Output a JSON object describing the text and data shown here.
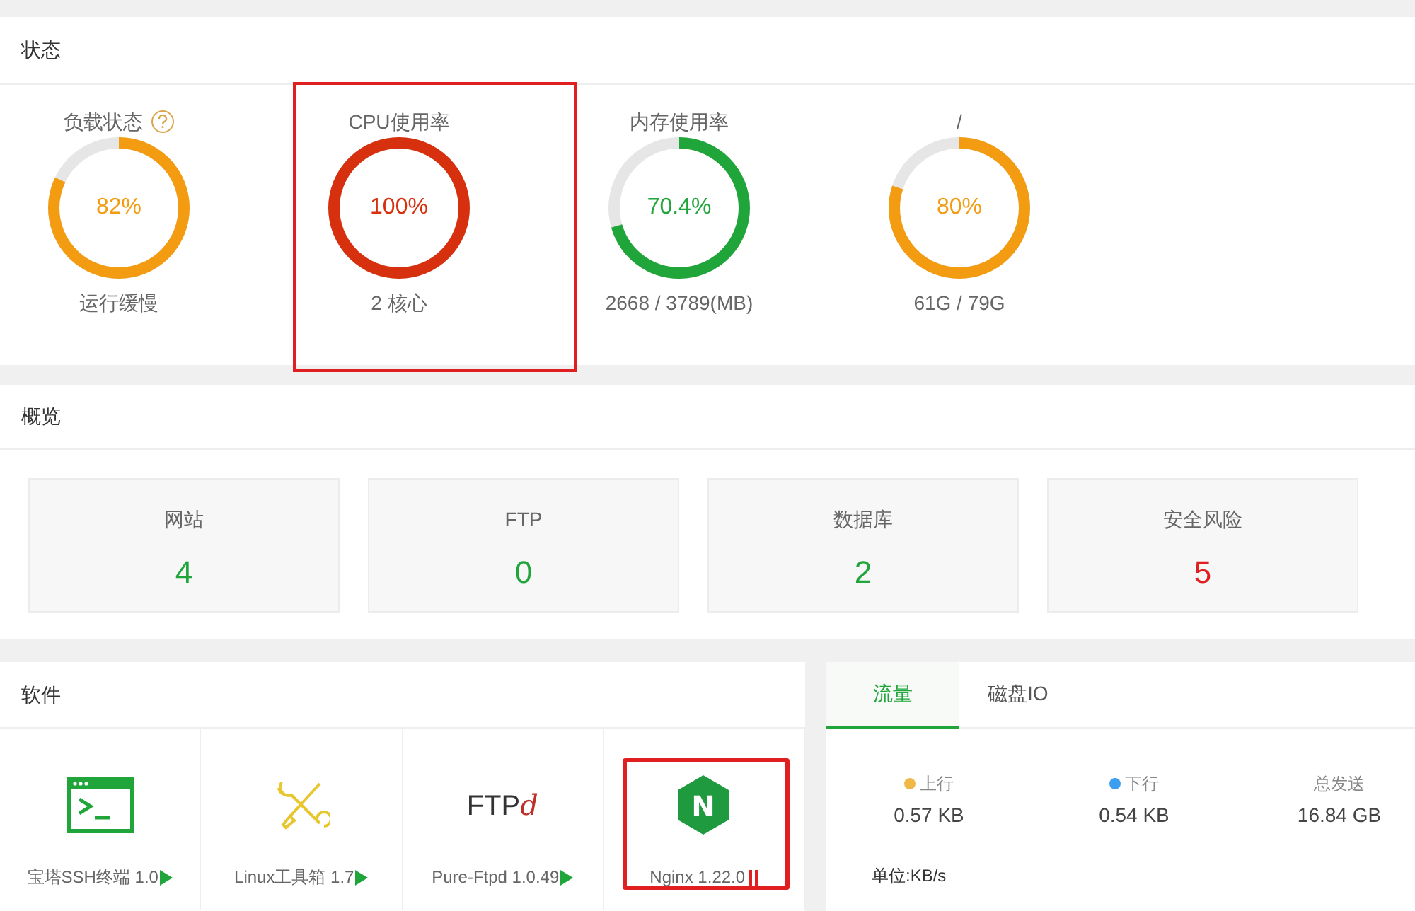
{
  "status": {
    "title": "状态",
    "gauges": [
      {
        "label": "负载状态",
        "help": true,
        "value": "82%",
        "level": 0.82,
        "color": "#f39c12",
        "detail": "运行缓慢",
        "highlighted": false
      },
      {
        "label": "CPU使用率",
        "help": false,
        "value": "100%",
        "level": 1,
        "color": "#d7300f",
        "detail": "2 核心",
        "highlighted": true
      },
      {
        "label": "内存使用率",
        "help": false,
        "value": "70.4%",
        "level": 0.704,
        "color": "#20a53a",
        "detail": "2668 / 3789(MB)",
        "highlighted": false
      },
      {
        "label": "/",
        "help": false,
        "value": "80%",
        "level": 0.8,
        "color": "#f39c12",
        "detail": "61G / 79G",
        "highlighted": false
      }
    ]
  },
  "overview": {
    "title": "概览",
    "tiles": [
      {
        "label": "网站",
        "value": "4",
        "alert": false
      },
      {
        "label": "FTP",
        "value": "0",
        "alert": false
      },
      {
        "label": "数据库",
        "value": "2",
        "alert": false
      },
      {
        "label": "安全风险",
        "value": "5",
        "alert": true
      }
    ]
  },
  "software": {
    "title": "软件",
    "items": [
      {
        "kind": "terminal",
        "name": "宝塔SSH终端 1.0",
        "running": true,
        "highlighted": false
      },
      {
        "kind": "tools",
        "name": "Linux工具箱 1.7",
        "running": true,
        "highlighted": false
      },
      {
        "kind": "ftpd",
        "logo_text": "FTP",
        "logo_accent": "d",
        "name": "Pure-Ftpd 1.0.49",
        "running": true,
        "highlighted": false
      },
      {
        "kind": "nginx",
        "logo_letter": "N",
        "name": "Nginx 1.22.0",
        "running": false,
        "highlighted": true
      }
    ]
  },
  "traffic": {
    "tabs": [
      {
        "label": "流量",
        "selected": true
      },
      {
        "label": "磁盘IO",
        "selected": false
      }
    ],
    "stats": [
      {
        "label": "上行",
        "value": "0.57 KB",
        "color": "#f0b849"
      },
      {
        "label": "下行",
        "value": "0.54 KB",
        "color": "#3c9ef0"
      },
      {
        "label": "总发送",
        "value": "16.84 GB"
      }
    ],
    "unit": "单位:KB/s"
  }
}
